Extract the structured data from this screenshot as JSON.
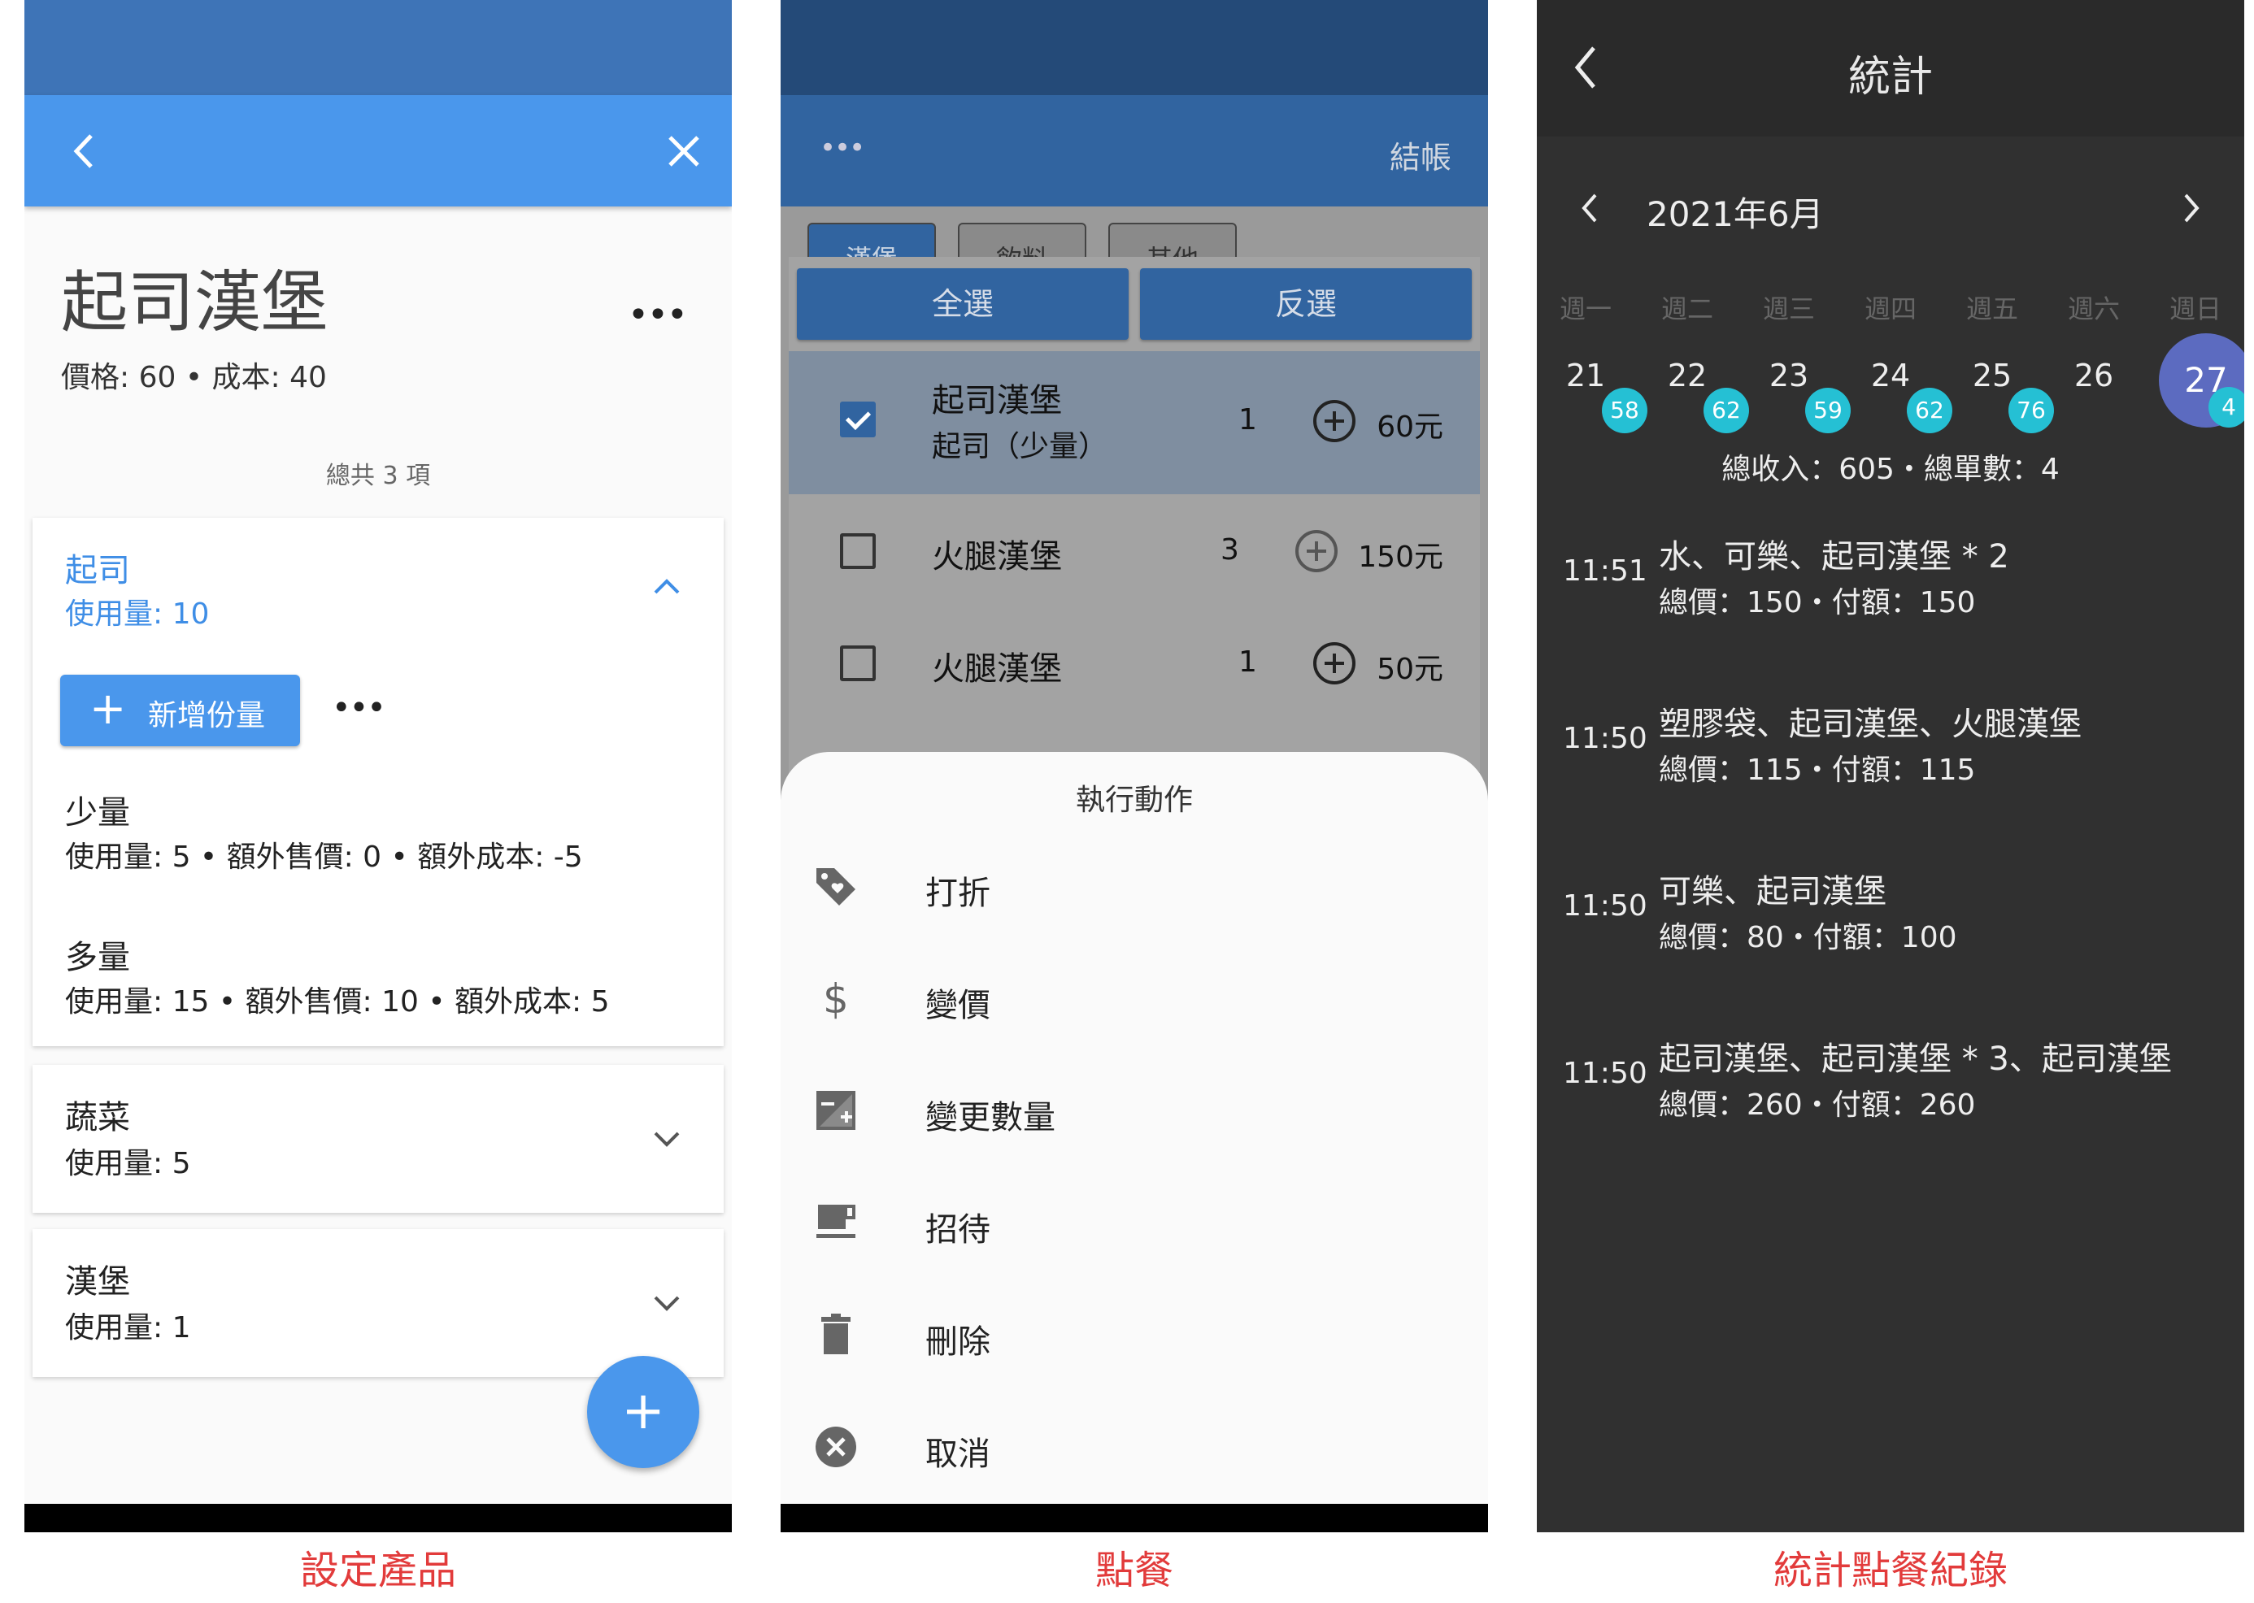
{
  "captions": {
    "product": "設定產品",
    "order": "點餐",
    "stats": "統計點餐紀錄"
  },
  "product": {
    "name": "起司漢堡",
    "price_cost": "價格: 60 • 成本: 40",
    "more": "•••",
    "total": "總共 3 項",
    "ingredients": [
      {
        "name": "起司",
        "usage": "使用量: 10",
        "expanded": true,
        "add_label": "新增份量",
        "more": "•••",
        "options": [
          {
            "name": "少量",
            "detail": "使用量: 5 • 額外售價: 0 • 額外成本: -5"
          },
          {
            "name": "多量",
            "detail": "使用量: 15 • 額外售價: 10 • 額外成本: 5"
          }
        ]
      },
      {
        "name": "蔬菜",
        "usage": "使用量: 5",
        "expanded": false
      },
      {
        "name": "漢堡",
        "usage": "使用量: 1",
        "expanded": false
      }
    ],
    "fab": "+"
  },
  "order": {
    "more": "•••",
    "checkout": "結帳",
    "tabs": [
      "漢堡",
      "飲料",
      "其他"
    ],
    "select_all": "全選",
    "invert": "反選",
    "items": [
      {
        "name": "起司漢堡",
        "sub": "起司（少量）",
        "qty": "1",
        "price": "60元",
        "checked": true
      },
      {
        "name": "火腿漢堡",
        "sub": "",
        "qty": "3",
        "price": "150元",
        "checked": false
      },
      {
        "name": "火腿漢堡",
        "sub": "",
        "qty": "1",
        "price": "50元",
        "checked": false
      }
    ],
    "sheet_title": "執行動作",
    "actions": [
      {
        "label": "打折",
        "icon": "tag-heart-icon"
      },
      {
        "label": "變價",
        "icon": "dollar-icon"
      },
      {
        "label": "變更數量",
        "icon": "plus-minus-box-icon"
      },
      {
        "label": "招待",
        "icon": "coffee-icon"
      },
      {
        "label": "刪除",
        "icon": "trash-icon"
      },
      {
        "label": "取消",
        "icon": "cancel-circle-icon"
      }
    ]
  },
  "stats": {
    "title": "統計",
    "month": "2021年6月",
    "weekdays": [
      "週一",
      "週二",
      "週三",
      "週四",
      "週五",
      "週六",
      "週日"
    ],
    "days": [
      {
        "day": "21",
        "count": "58"
      },
      {
        "day": "22",
        "count": "62"
      },
      {
        "day": "23",
        "count": "59"
      },
      {
        "day": "24",
        "count": "62"
      },
      {
        "day": "25",
        "count": "76"
      },
      {
        "day": "26",
        "count": ""
      },
      {
        "day": "27",
        "count": "4"
      }
    ],
    "summary": "總收入：605・總單數：4",
    "records": [
      {
        "time": "11:51",
        "items": "水、可樂、起司漢堡 * 2",
        "total": "總價：150・付額：150"
      },
      {
        "time": "11:50",
        "items": "塑膠袋、起司漢堡、火腿漢堡",
        "total": "總價：115・付額：115"
      },
      {
        "time": "11:50",
        "items": "可樂、起司漢堡",
        "total": "總價：80・付額：100"
      },
      {
        "time": "11:50",
        "items": "起司漢堡、起司漢堡 * 3、起司漢堡",
        "total": "總價：260・付額：260"
      }
    ]
  }
}
